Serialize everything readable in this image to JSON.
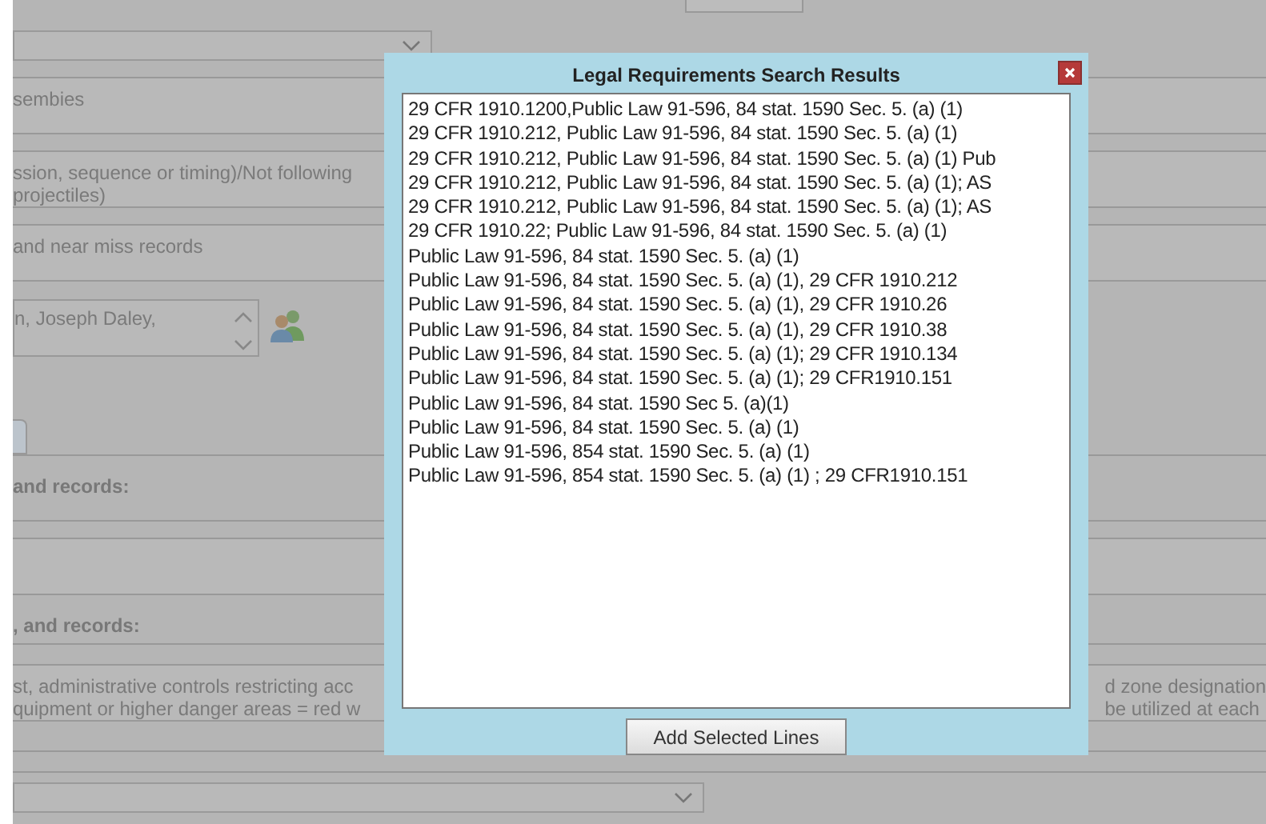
{
  "form_rows": [
    {
      "kind": "select"
    },
    {
      "kind": "field",
      "lines": [
        "sembies"
      ]
    },
    {
      "kind": "field",
      "lines": [
        "ssion, sequence or timing)/Not following",
        "projectiles)"
      ]
    },
    {
      "kind": "field",
      "lines": [
        "and near miss records"
      ]
    },
    {
      "kind": "people",
      "lines": [
        "n, Joseph Daley,"
      ]
    },
    {
      "kind": "tab"
    },
    {
      "kind": "label",
      "text": "and records:"
    },
    {
      "kind": "field",
      "lines": []
    },
    {
      "kind": "label",
      "text": ", and records:"
    },
    {
      "kind": "split",
      "lines": [
        "st, administrative controls restricting acc",
        "quipment or higher danger areas = red w"
      ],
      "right_lines": [
        "d zone designation",
        "be utilized at each"
      ]
    },
    {
      "kind": "blank"
    },
    {
      "kind": "select"
    }
  ],
  "dialog": {
    "title": "Legal Requirements Search Results",
    "results": [
      {
        "text": "29 CFR 1910.1200,Public Law 91-596, 84 stat. 1590 Sec. 5. (a) (1)",
        "selected": false
      },
      {
        "text": "29 CFR 1910.212, Public Law 91-596, 84 stat. 1590 Sec. 5. (a) (1)",
        "selected": false
      },
      {
        "text": "29 CFR 1910.212, Public Law 91-596, 84 stat. 1590 Sec. 5. (a) (1) Pub",
        "selected": false
      },
      {
        "text": "29 CFR 1910.212, Public Law 91-596, 84 stat. 1590 Sec. 5. (a) (1); AS",
        "selected": false
      },
      {
        "text": "29 CFR 1910.212, Public Law 91-596, 84 stat. 1590 Sec. 5. (a) (1); AS",
        "selected": false
      },
      {
        "text": "29 CFR 1910.22; Public Law 91-596, 84 stat. 1590 Sec. 5. (a) (1)",
        "selected": false
      },
      {
        "text": "Public Law 91-596, 84 stat. 1590 Sec. 5. (a) (1)",
        "selected": false
      },
      {
        "text": "Public Law 91-596, 84 stat. 1590 Sec. 5. (a) (1), 29 CFR 1910.212",
        "selected": false
      },
      {
        "text": "Public Law 91-596, 84 stat. 1590 Sec. 5. (a) (1), 29 CFR 1910.26",
        "selected": false
      },
      {
        "text": "Public Law 91-596, 84 stat. 1590 Sec. 5. (a) (1), 29 CFR 1910.38",
        "selected": false
      },
      {
        "text": "Public Law 91-596, 84 stat. 1590 Sec. 5. (a) (1); 29 CFR 1910.134",
        "selected": false
      },
      {
        "text": "Public Law 91-596, 84 stat. 1590 Sec. 5. (a) (1); 29 CFR1910.151",
        "selected": false
      },
      {
        "text": "Public Law 91-596, 84 stat. 1590 Sec 5. (a)(1)",
        "selected": false
      },
      {
        "text": "Public Law 91-596, 84 stat. 1590 Sec. 5. (a) (1)",
        "selected": false
      },
      {
        "text": "Public Law 91-596, 854 stat. 1590 Sec. 5. (a) (1)",
        "selected": false
      },
      {
        "text": "Public Law 91-596, 854 stat. 1590 Sec. 5. (a) (1) ; 29 CFR1910.151",
        "selected": false
      }
    ],
    "button": "Add Selected Lines"
  }
}
